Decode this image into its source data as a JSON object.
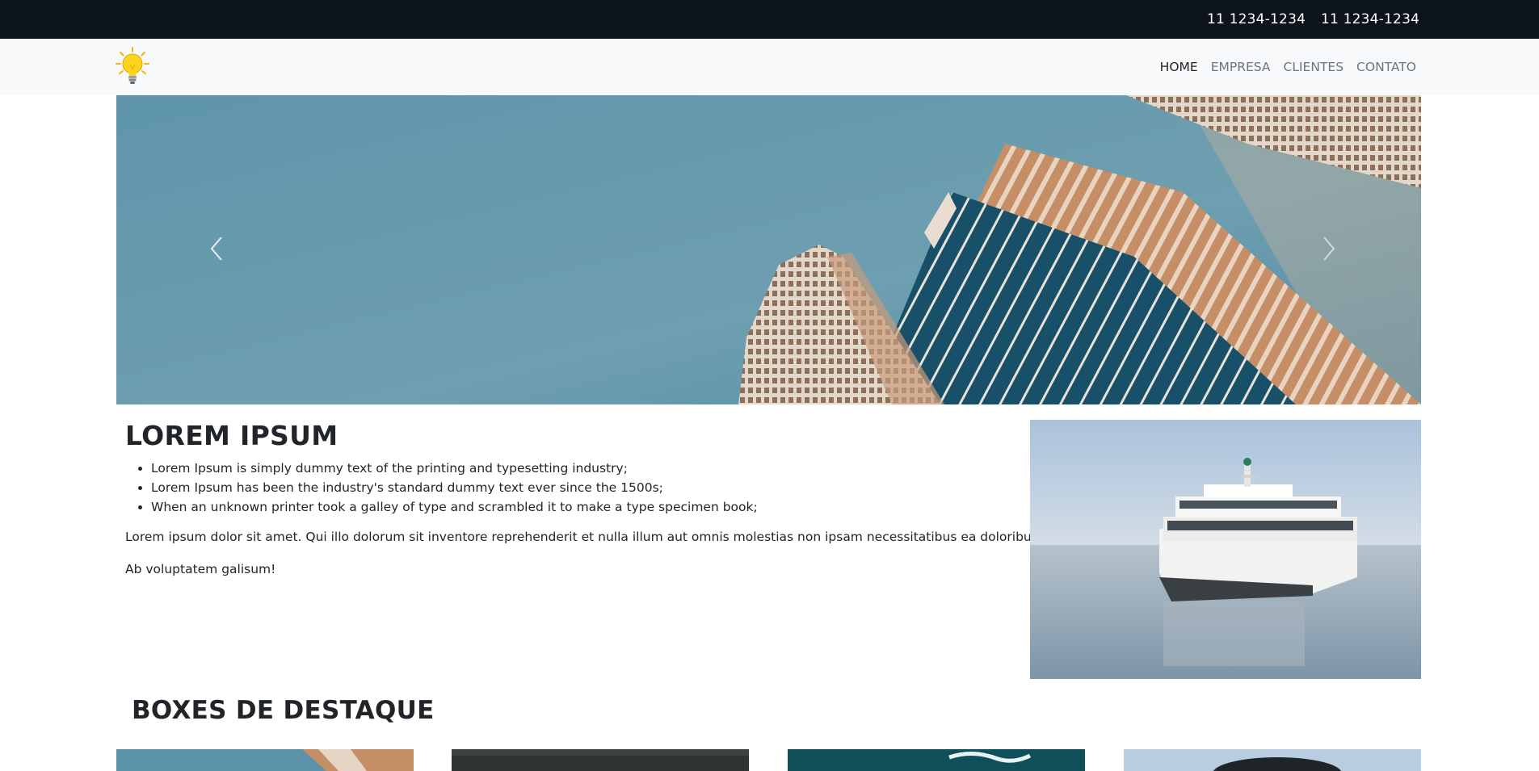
{
  "topbar": {
    "phones": [
      "11 1234-1234",
      "11 1234-1234"
    ]
  },
  "navbar": {
    "logo_icon": "lightbulb-icon",
    "items": [
      {
        "label": "HOME",
        "active": true
      },
      {
        "label": "EMPRESA",
        "active": false
      },
      {
        "label": "CLIENTES",
        "active": false
      },
      {
        "label": "CONTATO",
        "active": false
      }
    ]
  },
  "carousel": {
    "image": "skyscrapers-photo",
    "prev_icon": "chevron-left-icon",
    "next_icon": "chevron-right-icon"
  },
  "intro": {
    "title": "LOREM IPSUM",
    "bullets": [
      "Lorem Ipsum is simply dummy text of the printing and typesetting industry;",
      "Lorem Ipsum has been the industry's standard dummy text ever since the 1500s;",
      "When an unknown printer took a galley of type and scrambled it to make a type specimen book;"
    ],
    "paragraph_1": "Lorem ipsum dolor sit amet. Qui illo dolorum sit inventore reprehenderit et nulla illum aut omnis molestias non ipsam necessitatibus ea doloribus unde.",
    "paragraph_2": "Ab voluptatem galisum!",
    "image": "ferry-boat-photo"
  },
  "boxes": {
    "title": "BOXES DE DESTAQUE"
  },
  "colors": {
    "topbar_bg": "#0c131b",
    "navbar_bg": "#f8f9fa",
    "sky": "#5b93a8",
    "building": "#c48a62"
  }
}
